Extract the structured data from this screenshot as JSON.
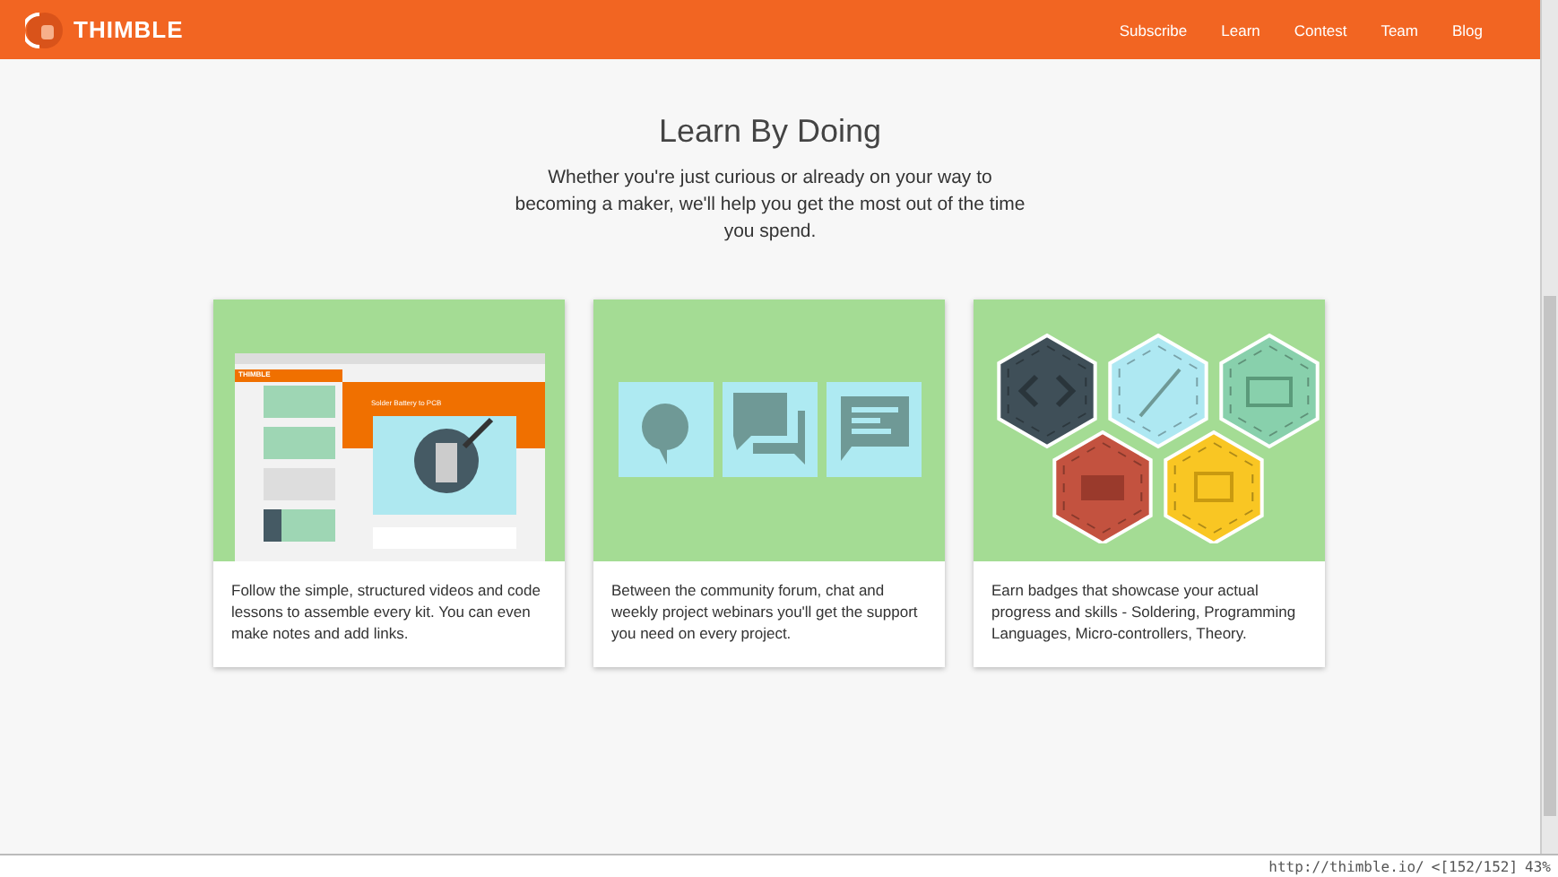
{
  "header": {
    "logo": "THIMBLE",
    "nav": [
      "Subscribe",
      "Learn",
      "Contest",
      "Team",
      "Blog"
    ]
  },
  "hero": {
    "title": "Learn By Doing",
    "subtitle": "Whether you're just curious or already on your way to becoming a maker, we'll help you get the most out of the time you spend."
  },
  "cards": [
    {
      "kind": "app-screenshot",
      "mock_logo": "THIMBLE",
      "mock_title": "Solder Battery to PCB",
      "text": "Follow the simple, structured videos and code lessons to assemble every kit. You can even make notes and add links."
    },
    {
      "kind": "chat-icons",
      "text": "Between the community forum, chat and weekly project webinars you'll get the support you need on every project."
    },
    {
      "kind": "badges",
      "text": "Earn badges that showcase your actual progress and skills - Soldering, Programming Languages, Micro-controllers, Theory."
    }
  ],
  "status_bar": {
    "url": "http://thimble.io/",
    "position": "<[152/152]",
    "percent": "43%"
  }
}
